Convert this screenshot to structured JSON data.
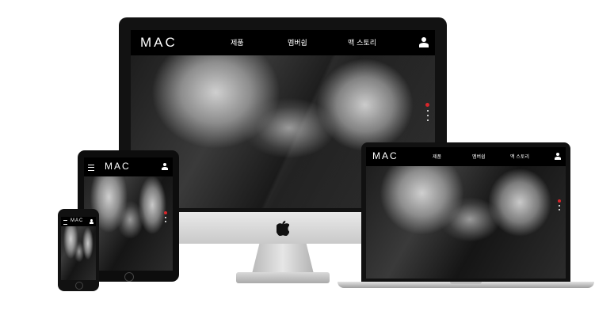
{
  "brand": {
    "logo_text": "MAC"
  },
  "nav": {
    "items": [
      "제품",
      "멤버쉽",
      "맥 스토리"
    ],
    "user_icon": "user-icon",
    "menu_icon": "hamburger-icon"
  },
  "hardware": {
    "imac_logo_icon": "apple-logo-icon"
  },
  "colors": {
    "nav_bg": "#000000",
    "accent_dot": "#d8262b",
    "chin": "#d6d6d6"
  }
}
